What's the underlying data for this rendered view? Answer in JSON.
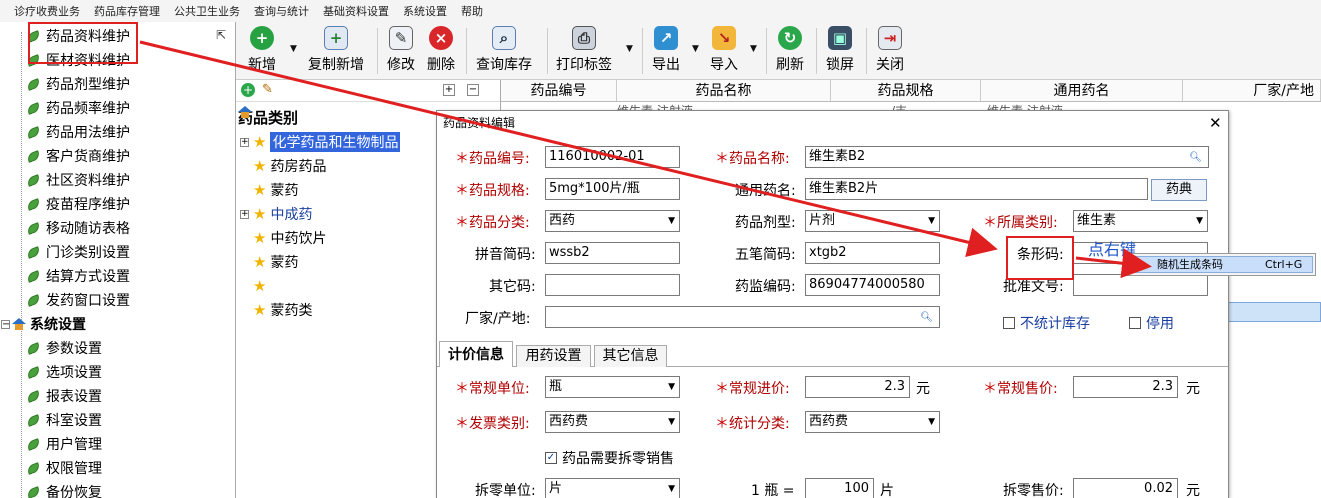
{
  "menubar": [
    "诊疗收费业务",
    "药品库存管理",
    "公共卫生业务",
    "查询与统计",
    "基础资料设置",
    "系统设置",
    "帮助"
  ],
  "nav": {
    "items": [
      "药品资料维护",
      "医材资料维护",
      "药品剂型维护",
      "药品频率维护",
      "药品用法维护",
      "客户货商维护",
      "社区资料维护",
      "疫苗程序维护",
      "移动随访表格",
      "门诊类别设置",
      "结算方式设置",
      "发药窗口设置"
    ],
    "section": "系统设置",
    "sub_items": [
      "参数设置",
      "选项设置",
      "报表设置",
      "科室设置",
      "用户管理",
      "权限管理",
      "备份恢复"
    ]
  },
  "toolbar": {
    "buttons": [
      "新增",
      "复制新增",
      "修改",
      "删除",
      "查询库存",
      "打印标签",
      "导出",
      "导入",
      "刷新",
      "锁屏",
      "关闭"
    ]
  },
  "category": {
    "title": "药品类别",
    "items": [
      "化学药品和生物制品",
      "药房药品",
      "蒙药",
      "中成药",
      "中药饮片",
      "蒙药",
      "",
      "蒙药类"
    ]
  },
  "grid": {
    "columns": [
      "药品编号",
      "药品名称",
      "药品规格",
      "通用药名",
      "厂家/产地"
    ],
    "row_partial": [
      "",
      "维生素   注射液",
      "    /支",
      "维生素   注射液",
      ""
    ]
  },
  "dialog": {
    "title": "药品资料编辑",
    "fields": {
      "code_label": "药品编号:",
      "code": "116010002-01",
      "name_label": "药品名称:",
      "name": "维生素B2",
      "spec_label": "药品规格:",
      "spec": "5mg*100片/瓶",
      "generic_label": "通用药名:",
      "generic": "维生素B2片",
      "pharmacopeia_button": "药典",
      "class_label": "药品分类:",
      "class": "西药",
      "form_label": "药品剂型:",
      "form": "片剂",
      "category_label": "所属类别:",
      "category": "维生素",
      "pinyin_label": "拼音简码:",
      "pinyin": "wssb2",
      "wubi_label": "五笔简码:",
      "wubi": "xtgb2",
      "barcode_label": "条形码:",
      "barcode": "",
      "other_label": "其它码:",
      "other": "",
      "regulatory_label": "药监编码:",
      "regulatory": "86904774000580",
      "approval_label": "批准文号:",
      "approval": "",
      "maker_label": "厂家/产地:",
      "maker": "",
      "no_stock_label": "不统计库存",
      "disabled_label": "停用"
    },
    "tabs": [
      "计价信息",
      "用药设置",
      "其它信息"
    ],
    "pricing": {
      "unit_label": "常规单位:",
      "unit": "瓶",
      "purchase_label": "常规进价:",
      "purchase": "2.3",
      "yuan1": "元",
      "sale_label": "常规售价:",
      "sale": "2.3",
      "yuan2": "元",
      "invoice_label": "发票类别:",
      "invoice": "西药费",
      "stat_label": "统计分类:",
      "stat": "西药费",
      "split_check": "药品需要拆零销售",
      "split_unit_label": "拆零单位:",
      "split_unit": "片",
      "ratio_prefix": "1 瓶 =",
      "ratio": "100",
      "ratio_unit": "片",
      "split_price_label": "拆零售价:",
      "split_price": "0.02",
      "yuan3": "元"
    }
  },
  "context_menu": {
    "item": "随机生成条码",
    "shortcut": "Ctrl+G"
  },
  "annotation": "点右键",
  "colors": {
    "highlight": "#e02020",
    "selection": "#3366dd",
    "annotation": "#1f56c8"
  }
}
